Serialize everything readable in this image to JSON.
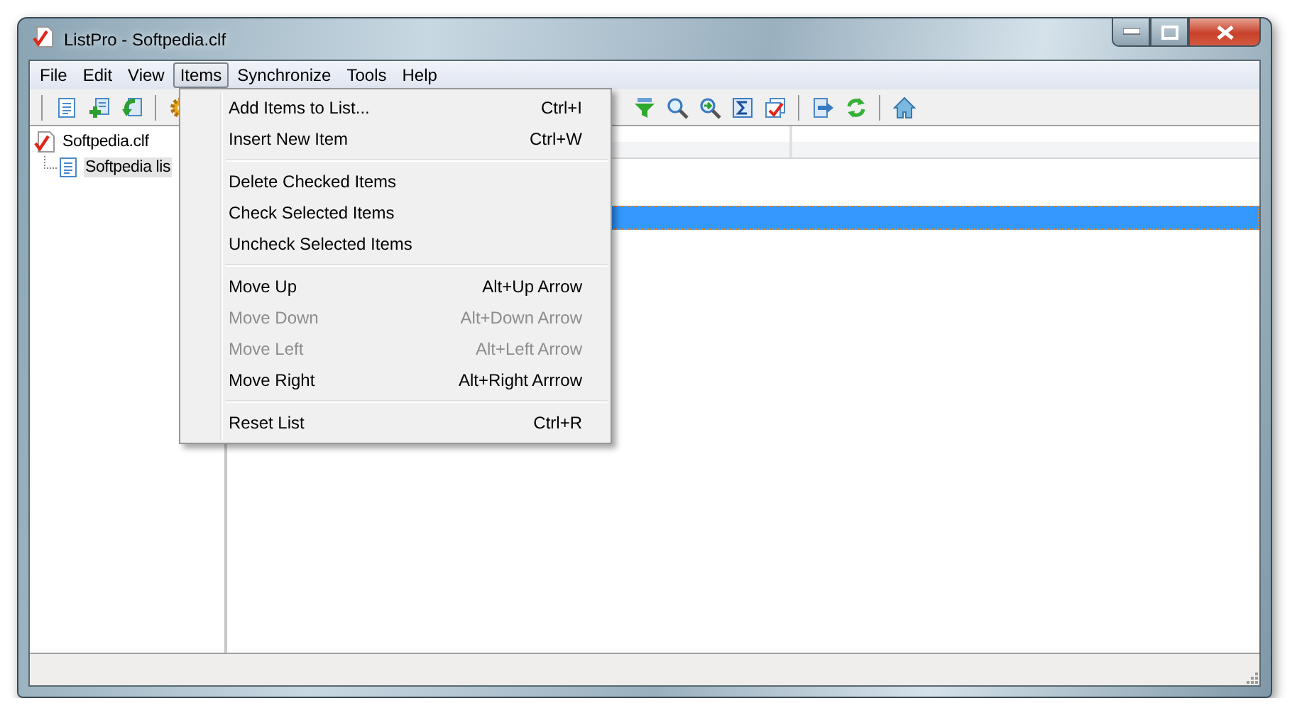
{
  "window": {
    "title": "ListPro - Softpedia.clf"
  },
  "menu_bar": [
    {
      "label": "File",
      "selected": false
    },
    {
      "label": "Edit",
      "selected": false
    },
    {
      "label": "View",
      "selected": false
    },
    {
      "label": "Items",
      "selected": true
    },
    {
      "label": "Synchronize",
      "selected": false
    },
    {
      "label": "Tools",
      "selected": false
    },
    {
      "label": "Help",
      "selected": false
    }
  ],
  "items_menu": [
    {
      "kind": "item",
      "label": "Add Items to List...",
      "shortcut": "Ctrl+I",
      "disabled": false
    },
    {
      "kind": "item",
      "label": "Insert New Item",
      "shortcut": "Ctrl+W",
      "disabled": false
    },
    {
      "kind": "separator"
    },
    {
      "kind": "item",
      "label": "Delete Checked Items",
      "disabled": false
    },
    {
      "kind": "item",
      "label": "Check Selected Items",
      "disabled": false
    },
    {
      "kind": "item",
      "label": "Uncheck Selected Items",
      "disabled": false
    },
    {
      "kind": "separator"
    },
    {
      "kind": "item",
      "label": "Move Up",
      "shortcut": "Alt+Up Arrow",
      "disabled": false
    },
    {
      "kind": "item",
      "label": "Move Down",
      "shortcut": "Alt+Down Arrow",
      "disabled": true
    },
    {
      "kind": "item",
      "label": "Move Left",
      "shortcut": "Alt+Left Arrow",
      "disabled": true
    },
    {
      "kind": "item",
      "label": "Move Right",
      "shortcut": "Alt+Right Arrrow",
      "disabled": false
    },
    {
      "kind": "separator"
    },
    {
      "kind": "item",
      "label": "Reset List",
      "shortcut": "Ctrl+R",
      "disabled": false
    }
  ],
  "tree": [
    {
      "label": "Softpedia.clf",
      "selected": false,
      "children": [
        {
          "label": "Softpedia lis",
          "selected": true
        }
      ]
    }
  ],
  "list": {
    "rows": [
      {
        "selected": false
      },
      {
        "selected": true
      }
    ]
  }
}
